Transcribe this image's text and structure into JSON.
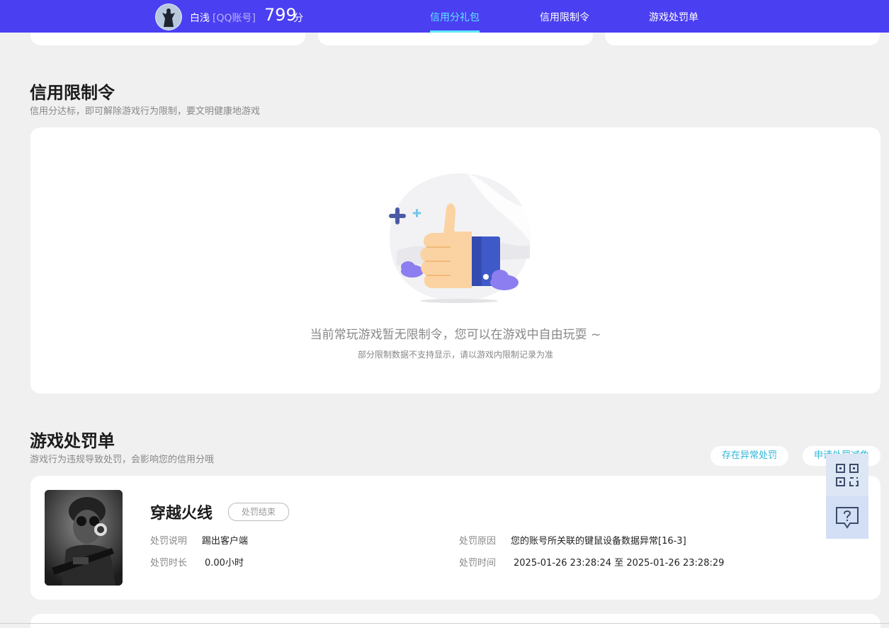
{
  "header": {
    "user_name": "白浅",
    "account_type": "[QQ账号]",
    "score": "799",
    "score_unit": "分",
    "tabs": [
      {
        "label": "信用分礼包",
        "active": true
      },
      {
        "label": "信用限制令",
        "active": false
      },
      {
        "label": "游戏处罚单",
        "active": false
      }
    ]
  },
  "restriction": {
    "title": "信用限制令",
    "subtitle": "信用分达标，即可解除游戏行为限制，要文明健康地游戏",
    "empty_message": "当前常玩游戏暂无限制令，您可以在游戏中自由玩耍 ~",
    "empty_note": "部分限制数据不支持显示，请以游戏内限制记录为准"
  },
  "penalty": {
    "title": "游戏处罚单",
    "subtitle": "游戏行为违规导致处罚，会影响您的信用分哦",
    "btn_abnormal": "存在异常处罚",
    "btn_apply": "申请处罚减免",
    "record": {
      "game": "穿越火线",
      "status": "处罚结束",
      "desc_label": "处罚说明",
      "desc_value": "踢出客户端",
      "duration_label": "处罚时长",
      "duration_value": "0.00小时",
      "reason_label": "处罚原因",
      "reason_value": "您的账号所关联的键鼠设备数据异常[16-3]",
      "time_label": "处罚时间",
      "time_value": "2025-01-26 23:28:24 至 2025-01-26 23:28:29"
    }
  },
  "icons": {
    "qr": "qr-code-icon",
    "help": "help-chat-icon"
  },
  "colors": {
    "nav_bg": "#4b3ff2",
    "nav_active": "#5ee6ff",
    "accent_link": "#2fb6d8"
  }
}
